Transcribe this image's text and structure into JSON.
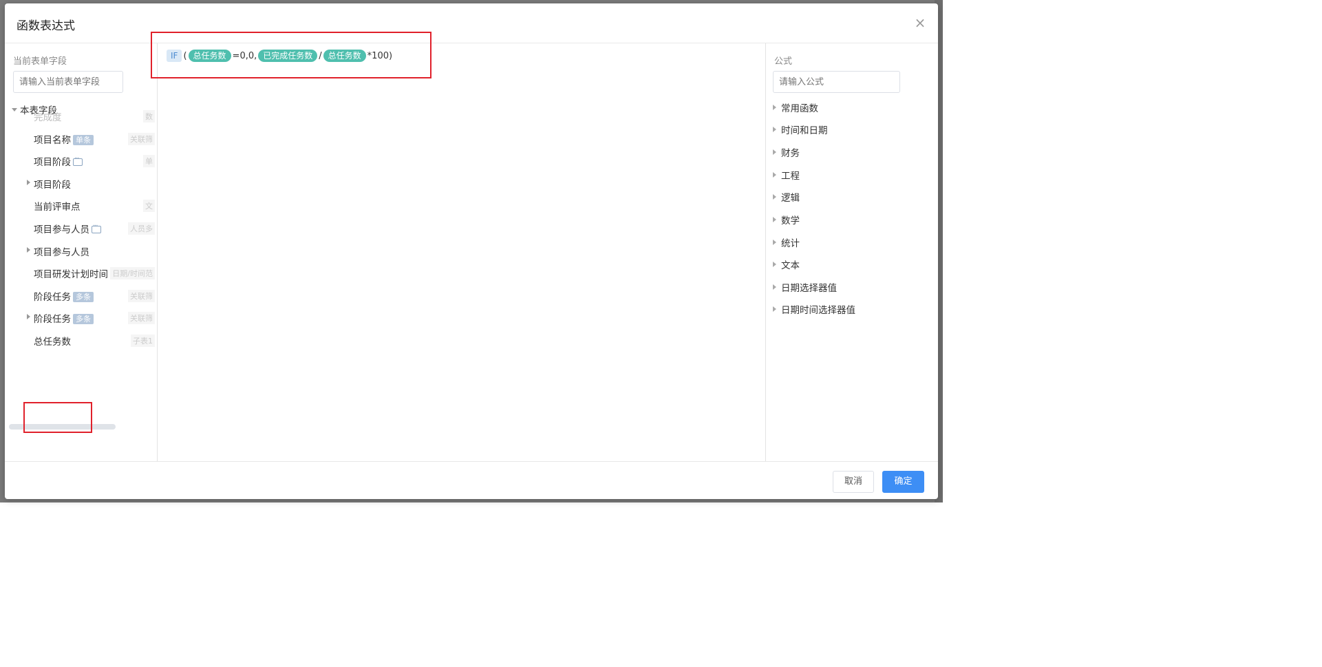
{
  "dialog": {
    "title": "函数表达式",
    "close_icon": "close-icon"
  },
  "left_pane": {
    "label": "当前表单字段",
    "search_placeholder": "请输入当前表单字段",
    "tree_root": "本表字段",
    "fields": [
      {
        "name": "完成度",
        "type": "数",
        "disabled": true
      },
      {
        "name": "项目名称",
        "tag": "单条",
        "type": "关联筛"
      },
      {
        "name": "项目阶段",
        "dots": true,
        "type": "单"
      },
      {
        "name": "项目阶段",
        "expandable": true
      },
      {
        "name": "当前评审点",
        "type": "文"
      },
      {
        "name": "项目参与人员",
        "dots": true,
        "type": "人员多"
      },
      {
        "name": "项目参与人员",
        "expandable": true
      },
      {
        "name": "项目研发计划时间",
        "type": "日期/时间范"
      },
      {
        "name": "阶段任务",
        "tag": "多条",
        "type": "关联筛"
      },
      {
        "name": "阶段任务",
        "tag": "多条",
        "expandable": true,
        "type": "关联筛"
      },
      {
        "name": "总任务数",
        "type": "子表1"
      }
    ]
  },
  "formula": {
    "fn": "IF",
    "open_paren": "(",
    "field1": "总任务数",
    "text1": "=0,0,",
    "field2": "已完成任务数",
    "op": "/",
    "field3": "总任务数",
    "text2": "*100)"
  },
  "right_pane": {
    "label": "公式",
    "search_placeholder": "请输入公式",
    "categories": [
      "常用函数",
      "时间和日期",
      "财务",
      "工程",
      "逻辑",
      "数学",
      "统计",
      "文本",
      "日期选择器值",
      "日期时间选择器值"
    ]
  },
  "footer": {
    "cancel": "取消",
    "ok": "确定"
  },
  "colors": {
    "primary": "#3d8ef5",
    "field_pill": "#4fbfae",
    "highlight": "#e0202a"
  }
}
